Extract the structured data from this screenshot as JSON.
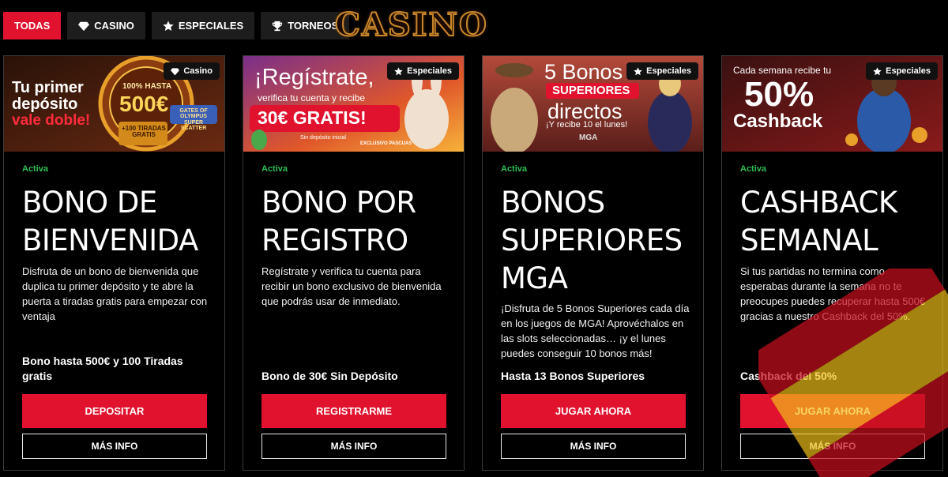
{
  "tabs": [
    {
      "label": "Todas",
      "active": true,
      "icon": ""
    },
    {
      "label": "Casino",
      "active": false,
      "icon": "diamond-icon"
    },
    {
      "label": "Especiales",
      "active": false,
      "icon": "star-icon"
    },
    {
      "label": "Torneos",
      "active": false,
      "icon": "trophy-icon"
    }
  ],
  "logo": "CASINO",
  "colors": {
    "accent": "#e0122e",
    "status": "#2fbf56",
    "card_border": "#3a3a3a"
  },
  "cards": [
    {
      "category": "Casino",
      "category_icon": "diamond-icon",
      "banner": {
        "line1": "Tu primer",
        "line2": "depósito",
        "line3": "vale doble!",
        "badge_top": "100% HASTA",
        "badge_amount": "500€",
        "badge_bottom": "+100 TIRADAS GRATIS",
        "game": "GATES OF OLYMPUS SUPER SCATTER"
      },
      "status": "Activa",
      "title": "Bono de Bienvenida",
      "description": "Disfruta de un bono de bienvenida que duplica tu primer depósito y te abre la puerta a tiradas gratis para empezar con ventaja",
      "highlight": "Bono hasta 500€ y 100 Tiradas gratis",
      "primary_label": "Depositar",
      "info_label": "Más info"
    },
    {
      "category": "Especiales",
      "category_icon": "star-icon",
      "banner": {
        "line1": "¡Regístrate,",
        "line2": "verifica tu cuenta y recibe",
        "line3": "30€ GRATIS!",
        "note": "Sin depósito inicial",
        "tag": "EXCLUSIVO PASCUAS"
      },
      "status": "Activa",
      "title": "Bono por Registro",
      "description": "Regístrate y verifica tu cuenta para recibir un bono exclusivo de bienvenida que podrás usar de inmediato.",
      "highlight": "Bono de 30€ Sin Depósito",
      "primary_label": "Registrarme",
      "info_label": "Más info"
    },
    {
      "category": "Especiales",
      "category_icon": "star-icon",
      "banner": {
        "line1": "5 Bonos",
        "line2": "SUPERIORES",
        "line3": "directos",
        "line4": "¡Y recibe 10 el lunes!",
        "mark": "MGA"
      },
      "status": "Activa",
      "title": "Bonos Superiores MGA",
      "description": "¡Disfruta de 5 Bonos Superiores cada día en los juegos de MGA! Aprovéchalos en las slots seleccionadas… ¡y el lunes puedes conseguir 10 bonos más!",
      "highlight": "Hasta 13 Bonos Superiores",
      "primary_label": "Jugar ahora",
      "info_label": "Más info"
    },
    {
      "category": "Especiales",
      "category_icon": "star-icon",
      "banner": {
        "line1": "Cada semana recibe tu",
        "line2": "50%",
        "line3": "Cashback"
      },
      "status": "Activa",
      "title": "Cashback Semanal",
      "description": "Si tus partidas no termina como esperabas durante la semana no te preocupes puedes recuperar hasta 500€ gracias a nuestro Cashback del 50%.",
      "highlight": "Cashback del 50%",
      "primary_label": "Jugar ahora",
      "info_label": "Más info"
    }
  ]
}
